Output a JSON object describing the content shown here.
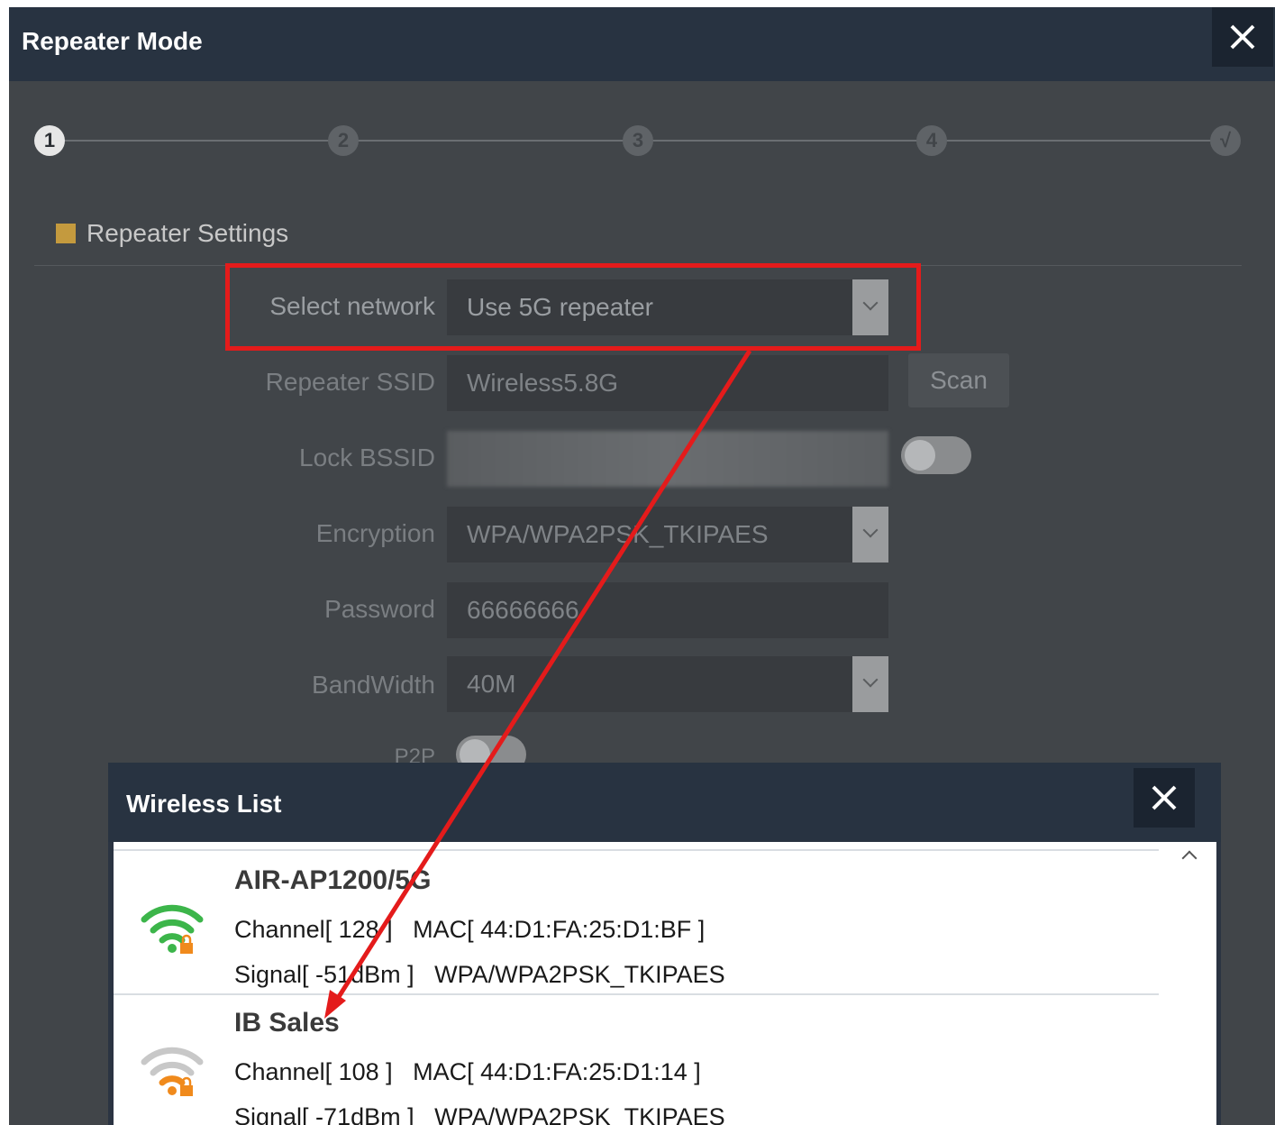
{
  "outer_dialog": {
    "title": "Repeater Mode",
    "steps": [
      "1",
      "2",
      "3",
      "4",
      "√"
    ],
    "section_title": "Repeater Settings",
    "form": {
      "select_network_label": "Select network",
      "select_network_value": "Use 5G repeater",
      "repeater_ssid_label": "Repeater SSID",
      "repeater_ssid_value": "Wireless5.8G",
      "scan_label": "Scan",
      "lock_bssid_label": "Lock BSSID",
      "encryption_label": "Encryption",
      "encryption_value": "WPA/WPA2PSK_TKIPAES",
      "password_label": "Password",
      "password_value": "66666666",
      "bandwidth_label": "BandWidth",
      "bandwidth_value": "40M",
      "p2p_label": "P2P"
    },
    "colors": {
      "accent": "#c49a3e",
      "highlight": "#e41b1b"
    }
  },
  "wireless_list": {
    "title": "Wireless List",
    "items": [
      {
        "name": "AIR-AP1200/5G",
        "channel_mac": "Channel[ 128 ]   MAC[ 44:D1:FA:25:D1:BF ]",
        "signal_enc": "Signal[ -51dBm ]   WPA/WPA2PSK_TKIPAES",
        "icon": "wifi-strong-locked-icon",
        "color": "#3cb54a"
      },
      {
        "name": "IB Sales",
        "channel_mac": "Channel[ 108 ]   MAC[ 44:D1:FA:25:D1:14 ]",
        "signal_enc": "Signal[ -71dBm ]   WPA/WPA2PSK_TKIPAES",
        "icon": "wifi-weak-locked-icon",
        "color": "#f08a1c"
      }
    ]
  }
}
